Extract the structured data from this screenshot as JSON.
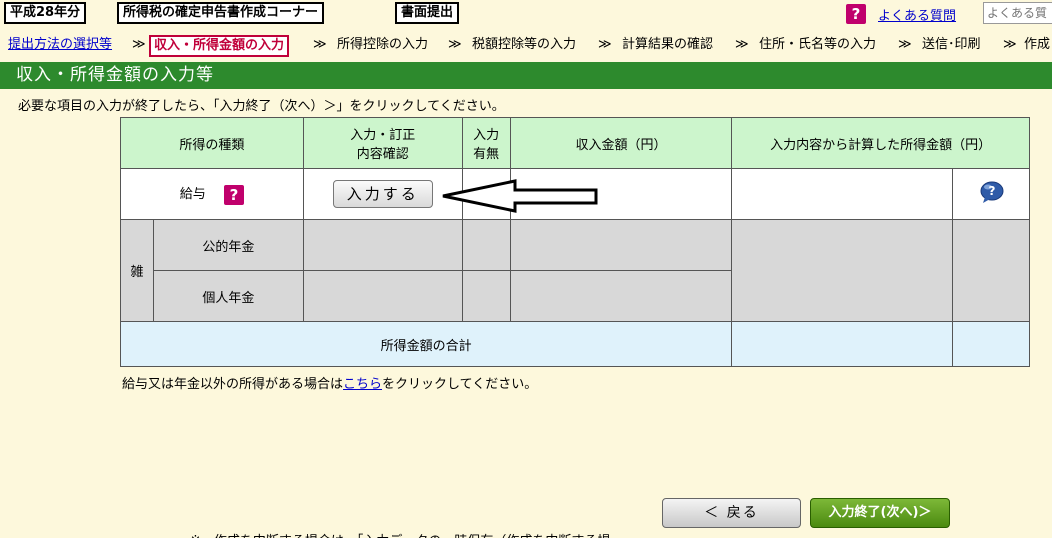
{
  "topbar": {
    "year_tag": "平成28年分",
    "corner_title": "所得税の確定申告書作成コーナー",
    "mode_tag": "書面提出",
    "faq_icon": "?",
    "faq_link": "よくある質問",
    "search_placeholder": "よくある質"
  },
  "steps": [
    "提出方法の選択等",
    "収入・所得金額の入力",
    "所得控除の入力",
    "税額控除等の入力",
    "計算結果の確認",
    "住所・氏名等の入力",
    "送信･印刷",
    "作成"
  ],
  "step_separator": "≫",
  "section_title": "収入・所得金額の入力等",
  "instruction": "必要な項目の入力が終了したら、「入力終了（次へ）＞」をクリックしてください。",
  "table": {
    "headers": {
      "income_type": "所得の種類",
      "input_confirm_line1": "入力・訂正",
      "input_confirm_line2": "内容確認",
      "input_exists_line1": "入力",
      "input_exists_line2": "有無",
      "revenue": "収入金額（円）",
      "computed_income": "入力内容から計算した所得金額（円）"
    },
    "salary_label": "給与",
    "salary_help": "?",
    "input_button": "入力する",
    "misc_label": "雑",
    "public_pension": "公的年金",
    "private_pension": "個人年金",
    "total_label": "所得金額の合計"
  },
  "note": {
    "before": "給与又は年金以外の所得がある場合は",
    "link": "こちら",
    "after": "をクリックしてください。"
  },
  "buttons": {
    "back": "＜ 戻る",
    "next": "入力終了(次へ)＞"
  },
  "bottom_note": "※　作成を中断する場合は、「入力データの一時保存（作成を中断する場"
}
